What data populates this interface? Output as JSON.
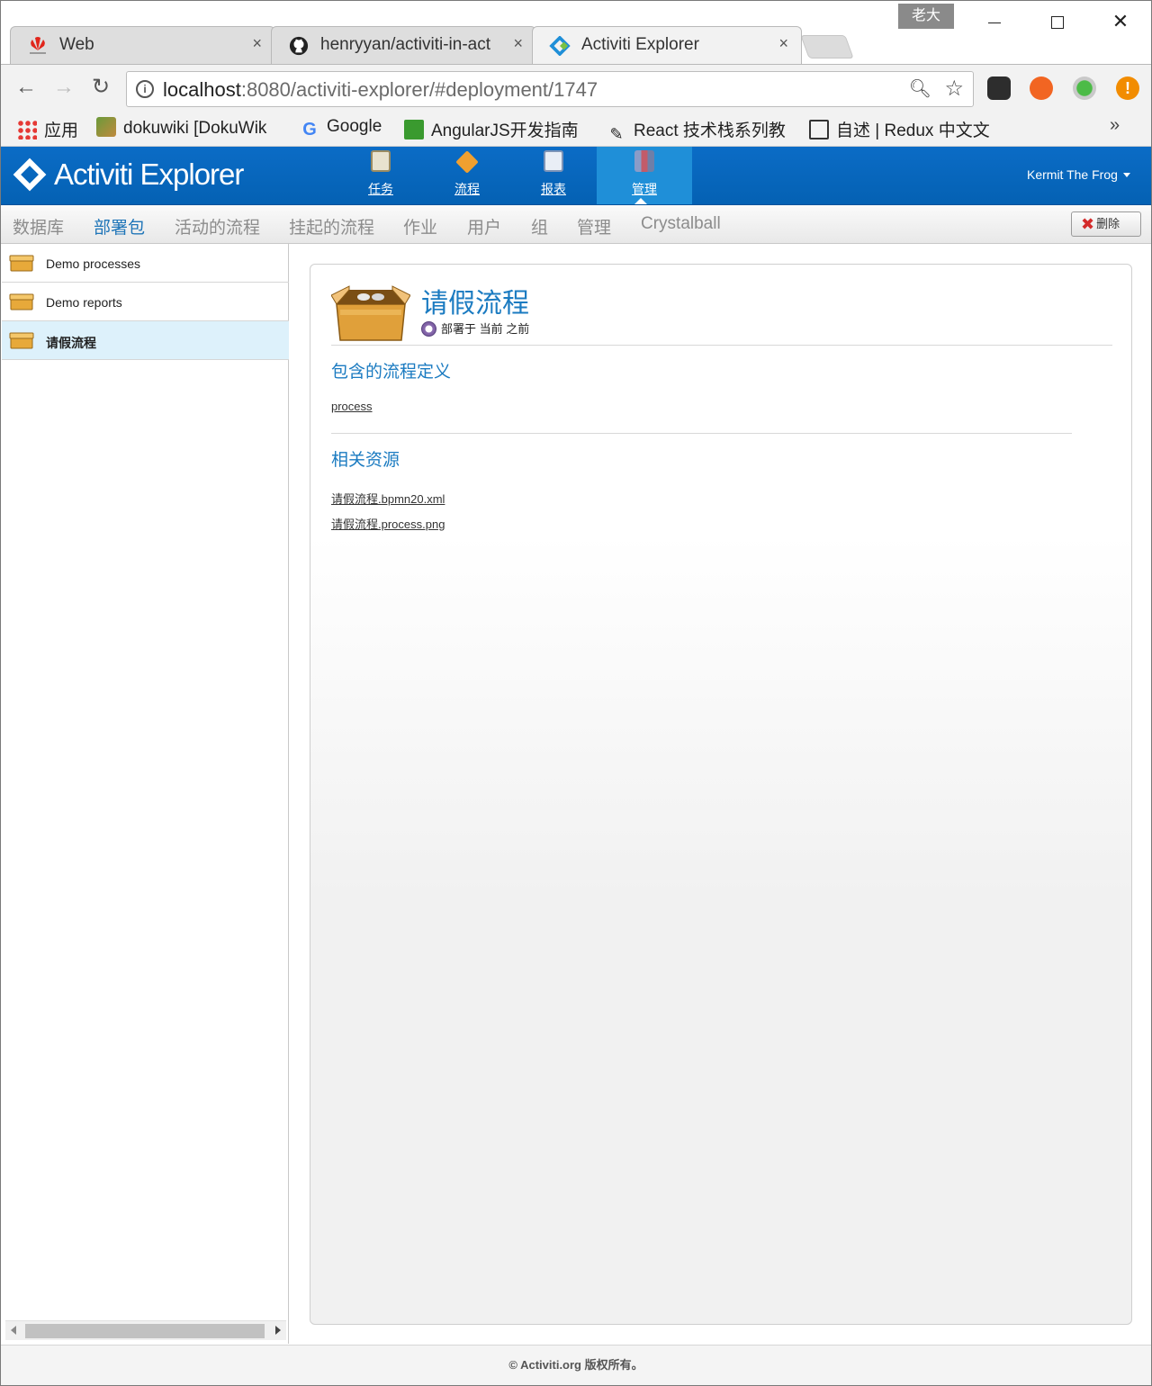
{
  "window": {
    "user_badge": "老大"
  },
  "tabs": [
    {
      "title": "Web",
      "close": "×"
    },
    {
      "title": "henryyan/activiti-in-act",
      "close": "×"
    },
    {
      "title": "Activiti Explorer",
      "close": "×"
    }
  ],
  "toolbar": {
    "url_host": "localhost",
    "url_rest": ":8080/activiti-explorer/#deployment/1747"
  },
  "bookmarks": [
    {
      "label": "应用"
    },
    {
      "label": "dokuwiki [DokuWik"
    },
    {
      "label": "Google"
    },
    {
      "label": "AngularJS开发指南"
    },
    {
      "label": "React 技术栈系列教"
    },
    {
      "label": "自述 | Redux 中文文"
    }
  ],
  "app": {
    "logo_text": "Activiti Explorer",
    "main_nav": [
      {
        "label": "任务"
      },
      {
        "label": "流程"
      },
      {
        "label": "报表"
      },
      {
        "label": "管理"
      }
    ],
    "user_name": "Kermit The Frog",
    "sub_nav": [
      {
        "label": "数据库"
      },
      {
        "label": "部署包"
      },
      {
        "label": "活动的流程"
      },
      {
        "label": "挂起的流程"
      },
      {
        "label": "作业"
      },
      {
        "label": "用户"
      },
      {
        "label": "组"
      },
      {
        "label": "管理"
      },
      {
        "label": "Crystalball"
      }
    ],
    "delete_label": "删除"
  },
  "deployments": [
    {
      "name": "Demo processes"
    },
    {
      "name": "Demo reports"
    },
    {
      "name": "请假流程"
    }
  ],
  "detail": {
    "title": "请假流程",
    "deployed_label": "部署于 当前 之前",
    "process_defs_heading": "包含的流程定义",
    "process_defs": [
      "process"
    ],
    "resources_heading": "相关资源",
    "resources": [
      "请假流程.bpmn20.xml",
      "请假流程.process.png"
    ]
  },
  "footer": {
    "text": "© Activiti.org 版权所有。"
  },
  "colors": {
    "header_blue": "#0461b3",
    "active_nav": "#1f8fd8",
    "link_blue": "#1b7bc1",
    "selected_row": "#ddf1fb"
  }
}
